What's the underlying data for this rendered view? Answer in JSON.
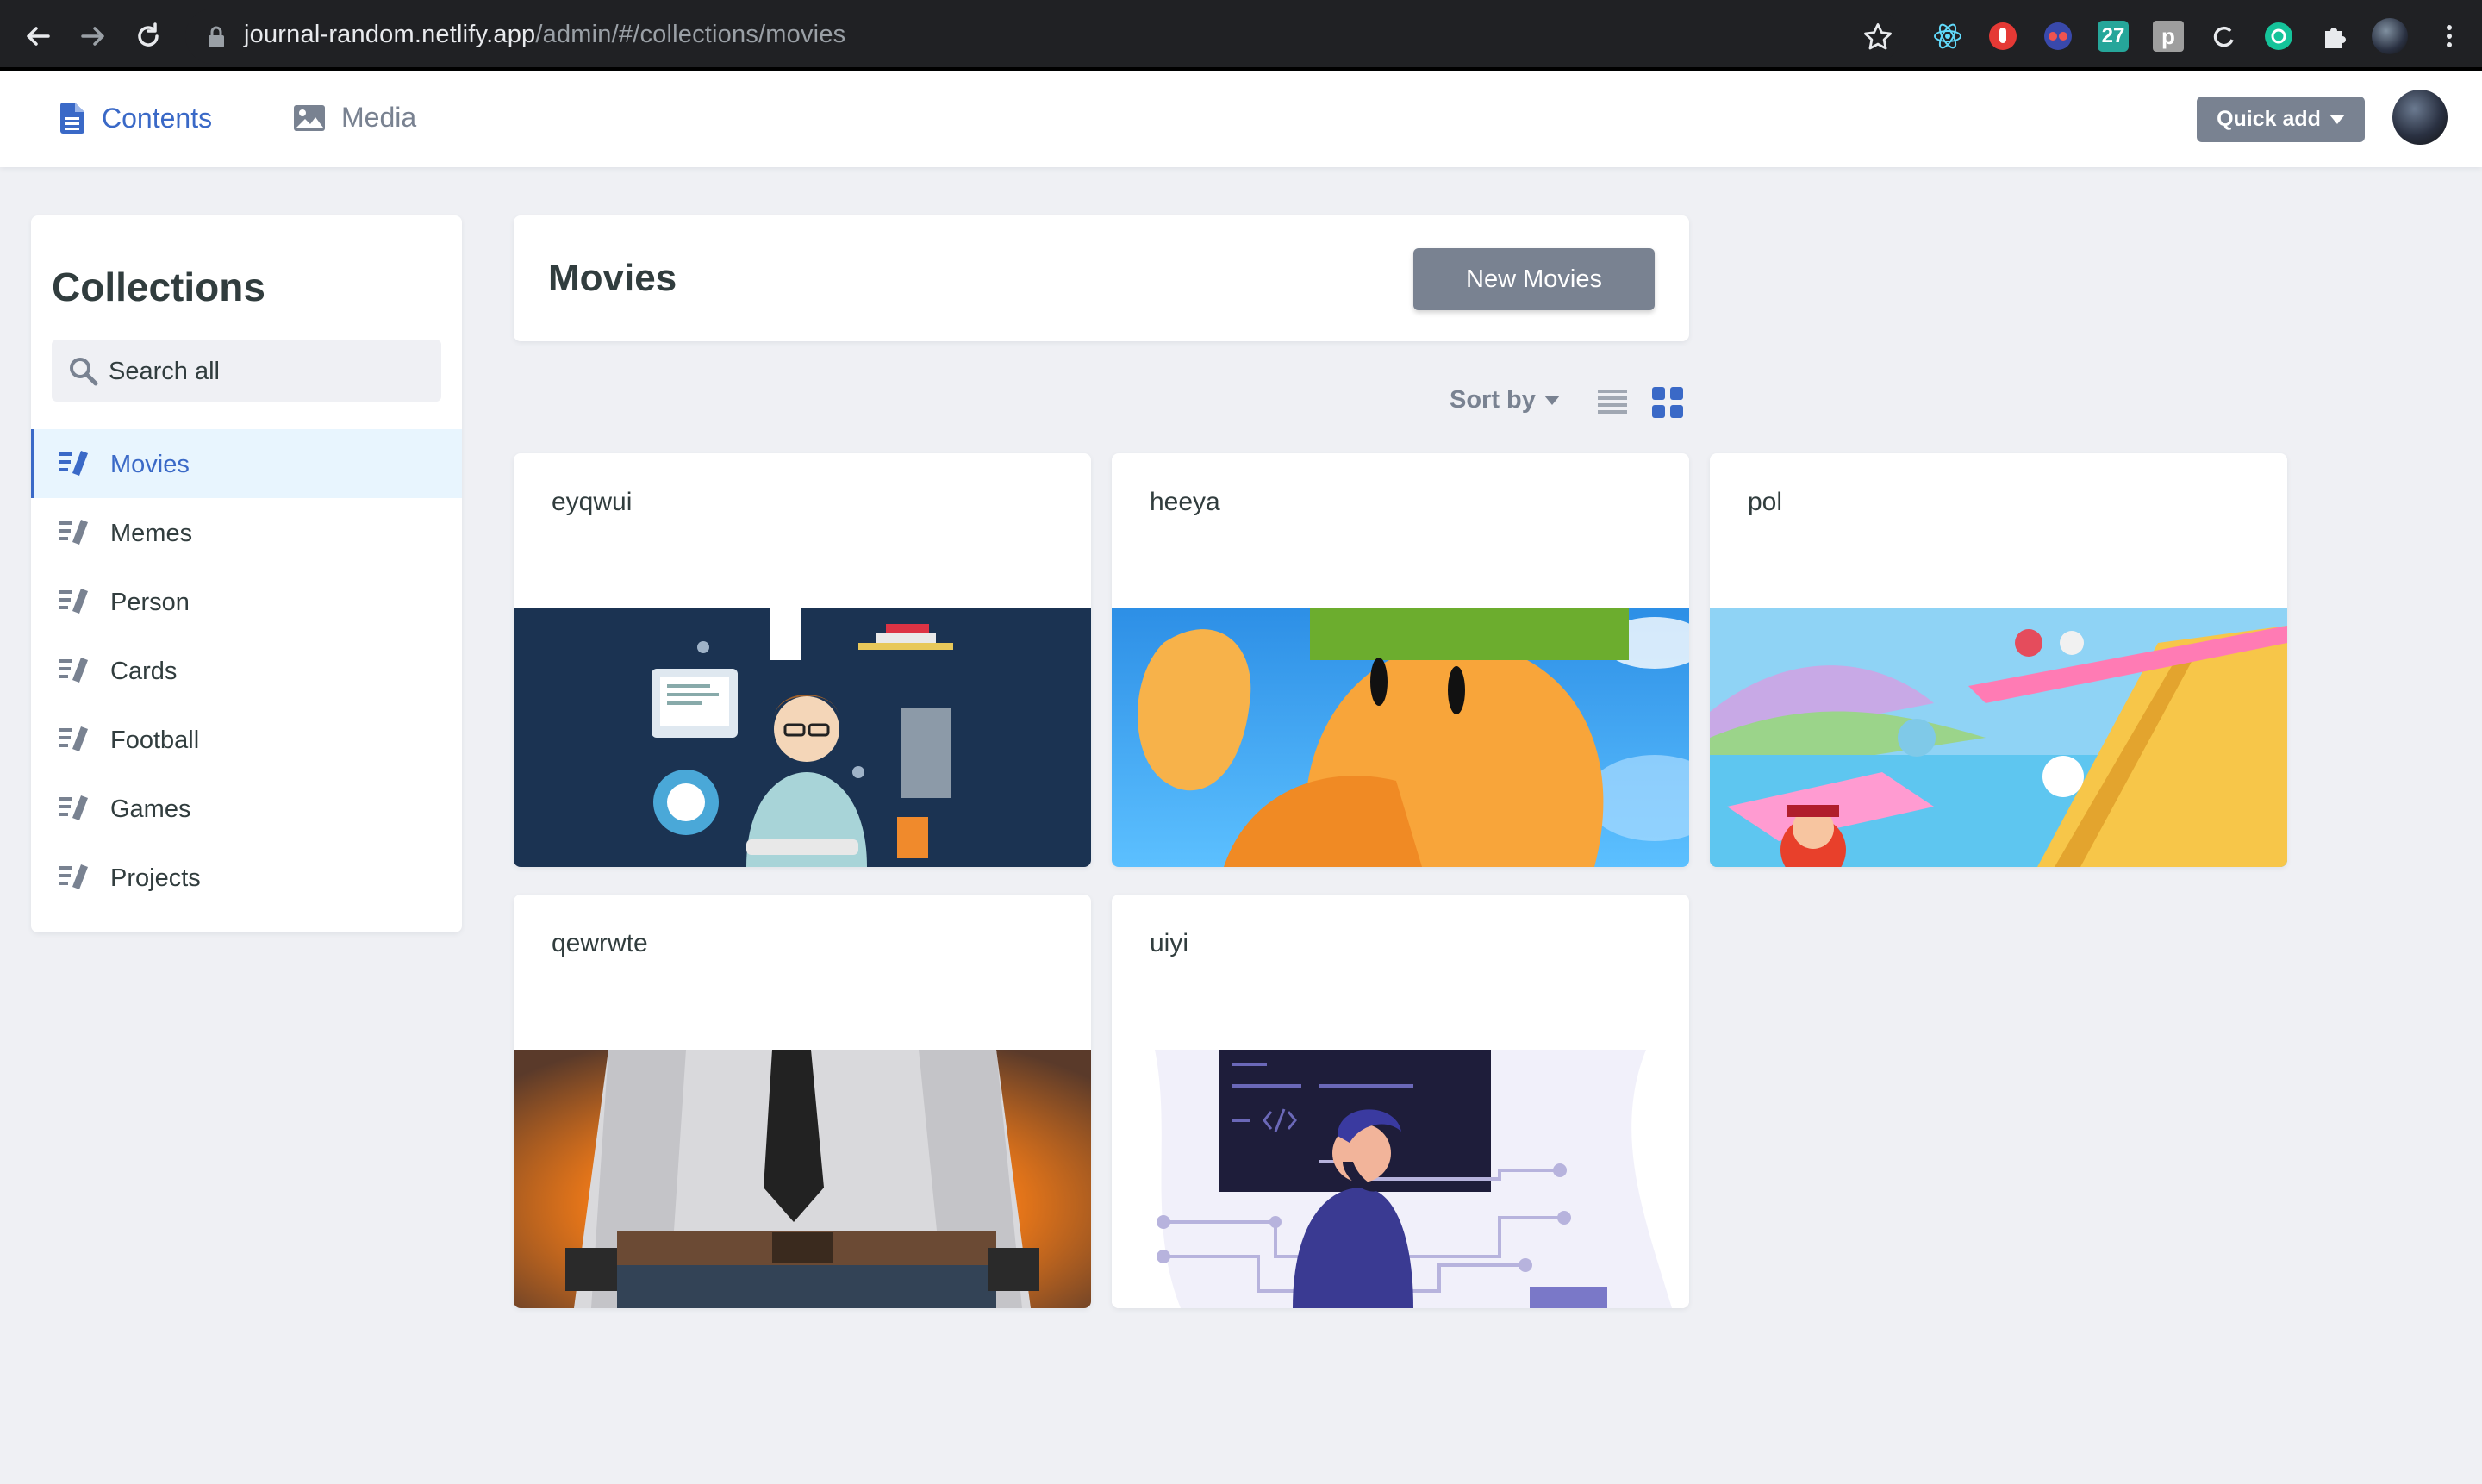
{
  "browser": {
    "url_host": "journal-random.netlify.app",
    "url_path": "/admin/#/collections/movies",
    "extension_badge": "27",
    "extension_letter": "p"
  },
  "header": {
    "nav": [
      {
        "label": "Contents",
        "icon": "document-icon"
      },
      {
        "label": "Media",
        "icon": "image-icon"
      }
    ],
    "quick_add_label": "Quick add"
  },
  "sidebar": {
    "title": "Collections",
    "search_placeholder": "Search all",
    "items": [
      {
        "label": "Movies"
      },
      {
        "label": "Memes"
      },
      {
        "label": "Person"
      },
      {
        "label": "Cards"
      },
      {
        "label": "Football"
      },
      {
        "label": "Games"
      },
      {
        "label": "Projects"
      }
    ]
  },
  "main": {
    "title": "Movies",
    "new_button_label": "New Movies",
    "sort_label": "Sort by",
    "cards": [
      {
        "title": "eyqwui",
        "image": "developer-illustration"
      },
      {
        "title": "heeya",
        "image": "stumble-guys-character"
      },
      {
        "title": "pol",
        "image": "fall-guys-scene"
      },
      {
        "title": "qewrwte",
        "image": "pubg-character"
      },
      {
        "title": "uiyi",
        "image": "coding-illustration"
      }
    ]
  },
  "colors": {
    "accent": "#3a69c7",
    "button_gray": "#798291",
    "background": "#eff0f4",
    "active_item_bg": "#e8f5fe"
  }
}
